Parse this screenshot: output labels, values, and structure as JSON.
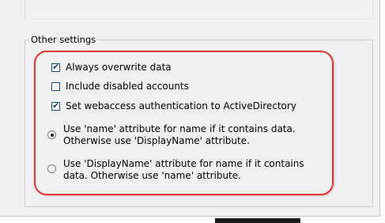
{
  "group": {
    "title": "Other settings"
  },
  "options": {
    "always_overwrite": {
      "label": "Always overwrite data",
      "checked": true
    },
    "include_disabled": {
      "label": "Include disabled accounts",
      "checked": false
    },
    "webaccess_auth": {
      "label": "Set webaccess authentication to ActiveDirectory",
      "checked": true
    },
    "radio_name": {
      "line1": "Use 'name' attribute for name if it contains data.",
      "line2": "Otherwise use 'DisplayName' attribute.",
      "selected": true
    },
    "radio_displayname": {
      "line1": "Use 'DisplayName' attribute for name if it contains",
      "line2": "data. Otherwise use 'name' attribute.",
      "selected": false
    }
  },
  "colors": {
    "highlight": "#e23535",
    "dialog_bg": "#f0f0f0"
  }
}
